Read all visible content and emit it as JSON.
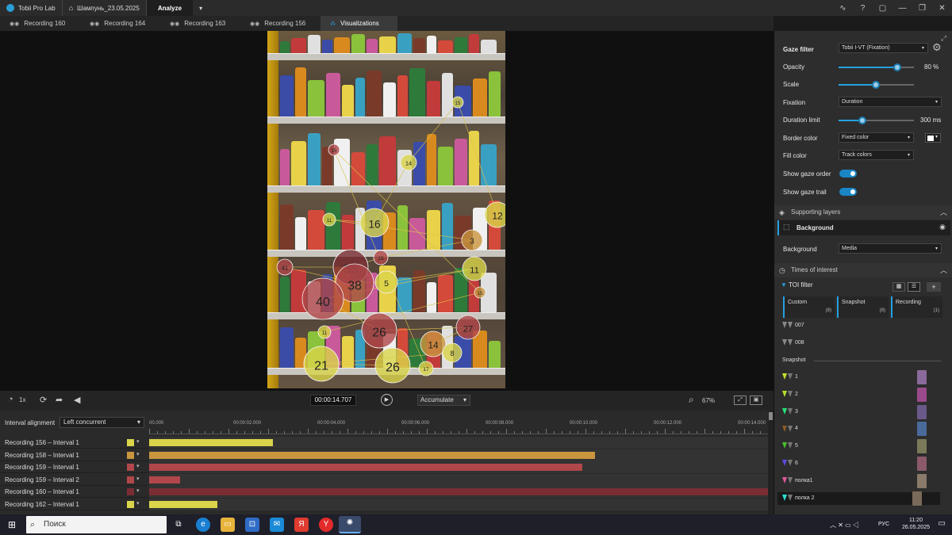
{
  "app": {
    "title": "Tobii Pro Lab",
    "project": "Шампунь_23.05.2025",
    "mode": "Analyze"
  },
  "tabs": [
    {
      "label": "Recording 160"
    },
    {
      "label": "Recording 164"
    },
    {
      "label": "Recording 163"
    },
    {
      "label": "Recording 156"
    },
    {
      "label": "Visualizations"
    }
  ],
  "gaze_numbers": [
    "15",
    "14",
    "16",
    "12",
    "11",
    "3",
    "15",
    "35",
    "41",
    "38",
    "5",
    "11",
    "40",
    "26",
    "27",
    "14",
    "8",
    "21",
    "26",
    "17",
    "15",
    "15",
    "11"
  ],
  "player": {
    "speed": "1x",
    "time": "00:00:14.707",
    "mode": "Accumulate",
    "zoom": "67%"
  },
  "timeline": {
    "alignment_label": "Interval alignment",
    "alignment_value": "Left concurrent",
    "ticks": [
      "00.000",
      "00:00:02.000",
      "00:00:04.000",
      "00:00:06.000",
      "00:00:08.000",
      "00:00:10.000",
      "00:00:12.000",
      "00:00:14.000"
    ],
    "rows": [
      {
        "label": "Recording 156 – Interval 1",
        "color": "#d9d44a",
        "fraction": 0.2
      },
      {
        "label": "Recording 158 – Interval 1",
        "color": "#c9953e",
        "fraction": 0.72
      },
      {
        "label": "Recording 159 – Interval 1",
        "color": "#b0474a",
        "fraction": 0.7
      },
      {
        "label": "Recording 159 – Interval 2",
        "color": "#b0474a",
        "fraction": 0.05
      },
      {
        "label": "Recording 160 – Interval 1",
        "color": "#7a2e34",
        "fraction": 1.0
      },
      {
        "label": "Recording 162 – Interval 1",
        "color": "#d9d44a",
        "fraction": 0.11
      }
    ]
  },
  "panel": {
    "gaze_filter_label": "Gaze filter",
    "gaze_filter": "Tobii I-VT (Fixation)",
    "opacity_label": "Opacity",
    "opacity_value": "80",
    "opacity_unit": "%",
    "scale_label": "Scale",
    "fixation_label": "Fixation",
    "fixation_value": "Duration",
    "duration_limit_label": "Duration limit",
    "duration_limit_value": "300",
    "duration_limit_unit": "ms",
    "border_color_label": "Border color",
    "border_color_value": "Fixed color",
    "fill_color_label": "Fill color",
    "fill_color_value": "Track colors",
    "show_gaze_order": "Show gaze order",
    "show_gaze_trail": "Show gaze trail",
    "supporting_layers": "Supporting layers",
    "background_layer": "Background",
    "background_label": "Background",
    "background_value": "Media",
    "toi_section": "Times of interest",
    "toi_filter": "TOI filter",
    "toi_cols": [
      {
        "label": "Custom",
        "count": "(8)"
      },
      {
        "label": "Snapshot",
        "count": "(8)"
      },
      {
        "label": "Recording",
        "count": "(1)"
      }
    ],
    "toi_custom": [
      "007",
      "008"
    ],
    "snapshot_label": "Snapshot",
    "snapshots": [
      {
        "label": "1",
        "color": "#c8e02a"
      },
      {
        "label": "2",
        "color": "#b2e02a"
      },
      {
        "label": "3",
        "color": "#2ae07a"
      },
      {
        "label": "4",
        "color": "#8a5a2a"
      },
      {
        "label": "5",
        "color": "#4ac02a"
      },
      {
        "label": "6",
        "color": "#5a4ae0"
      },
      {
        "label": "полка1",
        "color": "#e05a9a"
      },
      {
        "label": "полка 2",
        "color": "#2ae0d0"
      }
    ]
  },
  "taskbar": {
    "search": "Поиск",
    "lang": "РУС",
    "time": "11:20",
    "date": "26.05.2025"
  }
}
